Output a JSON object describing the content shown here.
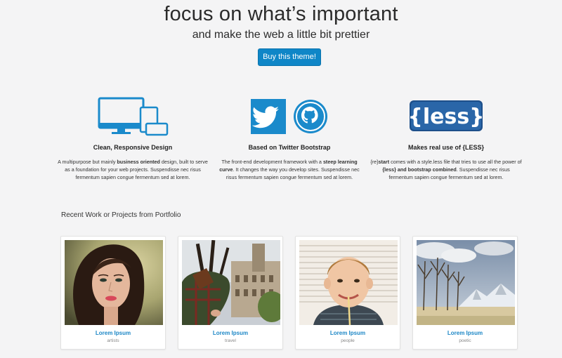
{
  "hero": {
    "title": "focus on what’s important",
    "subtitle": "and make the web a little bit prettier",
    "button_label": "Buy this theme!"
  },
  "features": [
    {
      "title": "Clean, Responsive Design",
      "icon": "devices-icon",
      "text_parts": [
        "A multipurpose but mainly ",
        "business oriented",
        " design, built to serve as a foundation for your web projects. Suspendisse nec risus fermentum sapien congue fermentum sed at lorem."
      ]
    },
    {
      "title": "Based on Twitter Bootstrap",
      "icon": "twitter-github-icon",
      "text_parts": [
        "The front-end development framework with a ",
        "steep learning curve",
        ". It changes the way you develop sites. Suspendisse nec risus fermentum sapien congue fermentum sed at lorem."
      ]
    },
    {
      "title": "Makes real use of {LESS}",
      "icon": "less-icon",
      "logo_text": "{less}",
      "text_parts": [
        "{re}",
        "start",
        " comes with a style.less file that tries to use all the power of ",
        "{less} and bootstrap combined",
        ". Suspendisse nec risus fermentum sapien congue fermentum sed at lorem."
      ]
    }
  ],
  "portfolio": {
    "heading": "Recent Work or Projects from Portfolio",
    "items": [
      {
        "title": "Lorem Ipsum",
        "tag": "artists"
      },
      {
        "title": "Lorem Ipsum",
        "tag": "travel"
      },
      {
        "title": "Lorem Ipsum",
        "tag": "people"
      },
      {
        "title": "Lorem Ipsum",
        "tag": "poetic"
      }
    ]
  },
  "colors": {
    "accent": "#0f86c7",
    "link": "#1d87c6",
    "background": "#f4f4f5"
  }
}
